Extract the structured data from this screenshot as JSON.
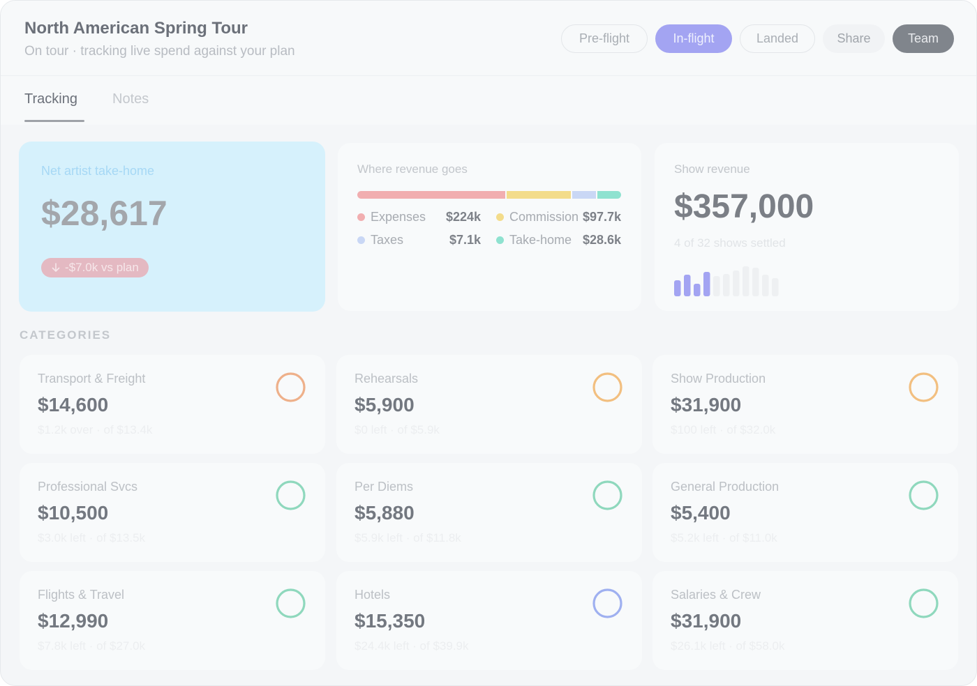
{
  "header": {
    "title": "North American Spring Tour",
    "subtitle": "On tour · tracking live spend against your plan",
    "phases": [
      "Pre-flight",
      "In-flight",
      "Landed"
    ],
    "active_phase": "In-flight",
    "share_label": "Share",
    "team_label": "Team"
  },
  "tabs": [
    {
      "label": "Tracking",
      "active": true
    },
    {
      "label": "Notes",
      "active": false
    }
  ],
  "takehome": {
    "label": "Net artist take-home",
    "value": "$28,617",
    "delta": "-$7.0k vs plan"
  },
  "revenue_split": {
    "label": "Where revenue goes",
    "items": [
      {
        "name": "Expenses",
        "value": "$224k",
        "amount": 224,
        "color": "#f1aeb0"
      },
      {
        "name": "Commission",
        "value": "$97.7k",
        "amount": 97.7,
        "color": "#f3dc8b"
      },
      {
        "name": "Taxes",
        "value": "$7.1k",
        "amount": 7.1,
        "color": "#c9d7f5"
      },
      {
        "name": "Take-home",
        "value": "$28.6k",
        "amount": 28.6,
        "color": "#8fe2d0"
      }
    ]
  },
  "show_revenue": {
    "label": "Show revenue",
    "value": "$357,000",
    "settled_text": "4 of 32 shows settled",
    "settled_color": "#a3a4f2",
    "pending_color": "#eef0f2",
    "bars": [
      {
        "level": 0.45,
        "settled": true
      },
      {
        "level": 0.6,
        "settled": true
      },
      {
        "level": 0.35,
        "settled": true
      },
      {
        "level": 0.68,
        "settled": true
      },
      {
        "level": 0.55,
        "settled": false
      },
      {
        "level": 0.62,
        "settled": false
      },
      {
        "level": 0.72,
        "settled": false
      },
      {
        "level": 0.82,
        "settled": false
      },
      {
        "level": 0.78,
        "settled": false
      },
      {
        "level": 0.6,
        "settled": false
      },
      {
        "level": 0.5,
        "settled": false
      }
    ]
  },
  "categories": {
    "heading": "CATEGORIES",
    "items": [
      {
        "name": "Transport & Freight",
        "amount": "$14,600",
        "sub": "$1.2k over · of $13.4k",
        "ring_color": "#eeb08a"
      },
      {
        "name": "Rehearsals",
        "amount": "$5,900",
        "sub": "$0 left · of $5.9k",
        "ring_color": "#f2bf80"
      },
      {
        "name": "Show Production",
        "amount": "$31,900",
        "sub": "$100 left · of $32.0k",
        "ring_color": "#f2bf80"
      },
      {
        "name": "Professional Svcs",
        "amount": "$10,500",
        "sub": "$3.0k left · of $13.5k",
        "ring_color": "#8fd8bd"
      },
      {
        "name": "Per Diems",
        "amount": "$5,880",
        "sub": "$5.9k left · of $11.8k",
        "ring_color": "#8fd8bd"
      },
      {
        "name": "General Production",
        "amount": "$5,400",
        "sub": "$5.2k left · of $11.0k",
        "ring_color": "#8fd8bd"
      },
      {
        "name": "Flights & Travel",
        "amount": "$12,990",
        "sub": "$7.8k left · of $27.0k",
        "ring_color": "#8fd8bd"
      },
      {
        "name": "Hotels",
        "amount": "$15,350",
        "sub": "$24.4k left · of $39.9k",
        "ring_color": "#9fb0f0"
      },
      {
        "name": "Salaries & Crew",
        "amount": "$31,900",
        "sub": "$26.1k left · of $58.0k",
        "ring_color": "#8fd8bd"
      }
    ]
  }
}
